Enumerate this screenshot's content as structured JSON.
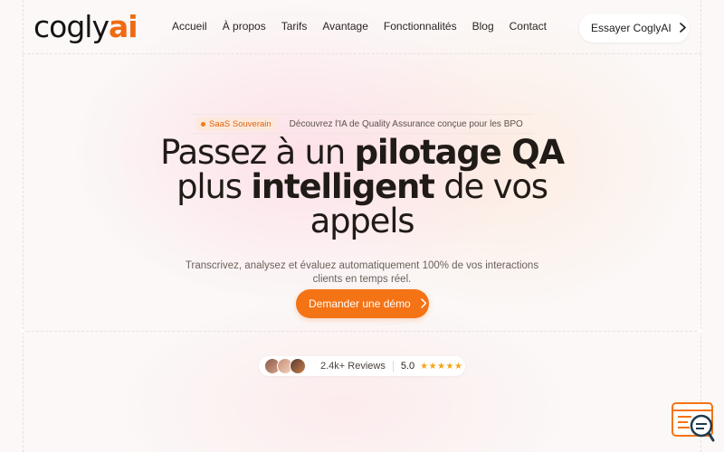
{
  "brand": {
    "logo_main": "cogly",
    "logo_accent": "ai",
    "accent_color": "#f47315"
  },
  "nav": {
    "items": [
      {
        "label": "Accueil"
      },
      {
        "label": "À propos"
      },
      {
        "label": "Tarifs"
      },
      {
        "label": "Avantage"
      },
      {
        "label": "Fonctionnalités"
      },
      {
        "label": "Blog"
      },
      {
        "label": "Contact"
      }
    ],
    "cta_label": "Essayer CoglyAI",
    "cta_icon": "chevron-right-icon"
  },
  "hero": {
    "badge_tag": "SaaS Souverain",
    "badge_text": "Découvrez l'IA de Quality Assurance conçue pour les BPO",
    "headline_part1": "Passez à un ",
    "headline_bold1": "pilotage QA",
    "headline_part2": "plus ",
    "headline_bold2": "intelligent",
    "headline_part3": " de vos appels",
    "subtitle": "Transcrivez, analysez et évaluez automatiquement 100% de vos interactions clients en temps réel.",
    "cta_label": "Demander une démo",
    "cta_icon": "chevron-right-icon"
  },
  "reviews": {
    "count_label": "2.4k+ Reviews",
    "rating": "5.0",
    "stars": "★★★★★"
  },
  "chat_widget": {
    "icon": "chat-search-icon"
  }
}
